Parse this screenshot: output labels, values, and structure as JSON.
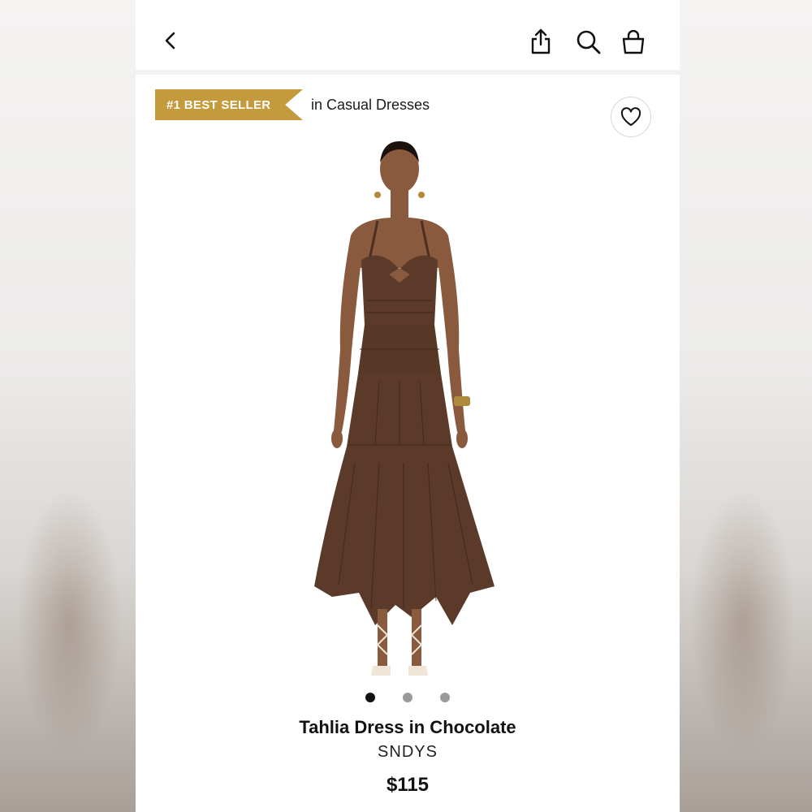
{
  "badge": {
    "label": "#1 BEST SELLER",
    "category": "in Casual Dresses",
    "color": "#c49a3c"
  },
  "header": {
    "icons": [
      "chevron-left-icon",
      "share-icon",
      "search-icon",
      "shopping-bag-icon"
    ]
  },
  "gallery": {
    "total_images": 3,
    "active_index": 0
  },
  "product": {
    "name": "Tahlia Dress in Chocolate",
    "brand": "SNDYS",
    "price": "$115",
    "dress_color": "#5b3a29"
  }
}
